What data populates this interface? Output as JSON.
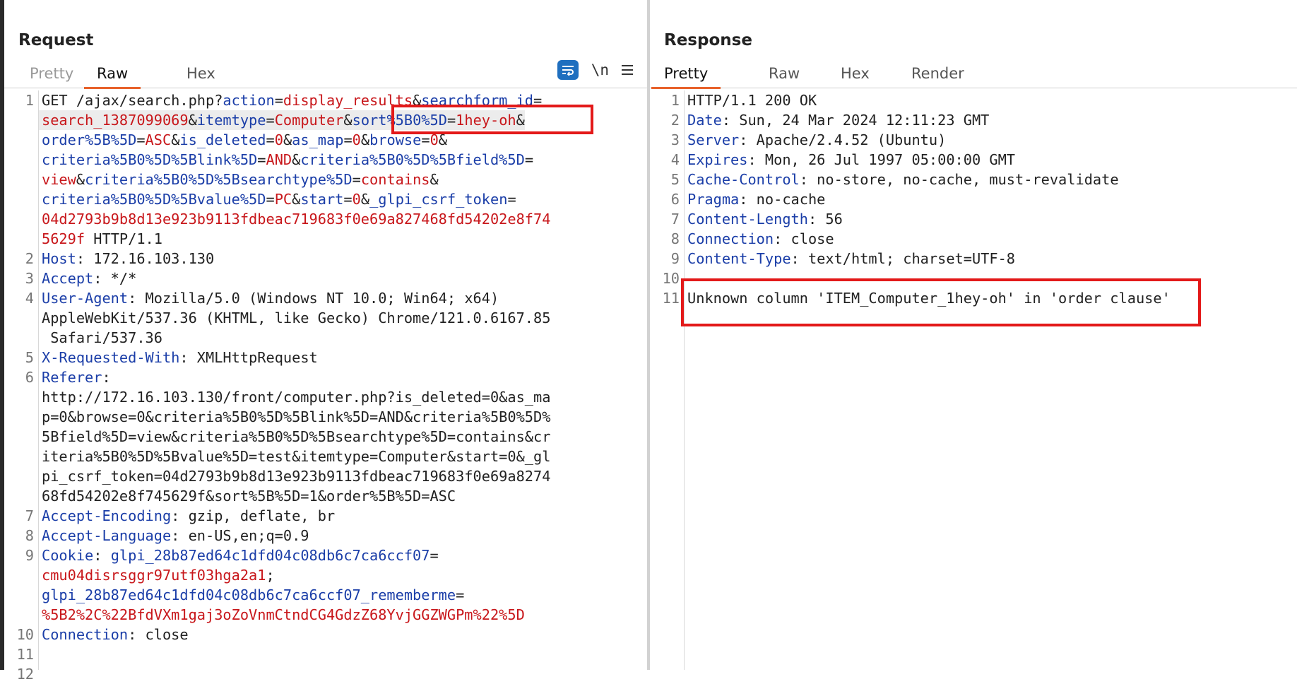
{
  "request": {
    "title": "Request",
    "tabs": [
      "Pretty",
      "Raw",
      "Hex"
    ],
    "active_tab": "Raw",
    "tools": {
      "newline_toggle": "\\n"
    },
    "lines": [
      {
        "num": "1",
        "rows": [
          [
            {
              "t": "GET /ajax/search.php?",
              "c": "p"
            },
            {
              "t": "action",
              "c": "k"
            },
            {
              "t": "=",
              "c": "p"
            },
            {
              "t": "display_results",
              "c": "v"
            },
            {
              "t": "&",
              "c": "p"
            },
            {
              "t": "searchform_id",
              "c": "k"
            },
            {
              "t": "=",
              "c": "p"
            }
          ],
          [
            {
              "t": "search_1387099069",
              "c": "v"
            },
            {
              "t": "&",
              "c": "p"
            },
            {
              "t": "itemtype",
              "c": "k"
            },
            {
              "t": "=",
              "c": "p"
            },
            {
              "t": "Computer",
              "c": "v"
            },
            {
              "t": "&",
              "c": "p"
            },
            {
              "t": "sort%5B0%5D",
              "c": "k"
            },
            {
              "t": "=",
              "c": "p"
            },
            {
              "t": "1hey-oh",
              "c": "v"
            },
            {
              "t": "&",
              "c": "p"
            }
          ],
          [
            {
              "t": "order%5B%5D",
              "c": "k"
            },
            {
              "t": "=",
              "c": "p"
            },
            {
              "t": "ASC",
              "c": "v"
            },
            {
              "t": "&",
              "c": "p"
            },
            {
              "t": "is_deleted",
              "c": "k"
            },
            {
              "t": "=",
              "c": "p"
            },
            {
              "t": "0",
              "c": "v"
            },
            {
              "t": "&",
              "c": "p"
            },
            {
              "t": "as_map",
              "c": "k"
            },
            {
              "t": "=",
              "c": "p"
            },
            {
              "t": "0",
              "c": "v"
            },
            {
              "t": "&",
              "c": "p"
            },
            {
              "t": "browse",
              "c": "k"
            },
            {
              "t": "=",
              "c": "p"
            },
            {
              "t": "0",
              "c": "v"
            },
            {
              "t": "&",
              "c": "p"
            }
          ],
          [
            {
              "t": "criteria%5B0%5D%5Blink%5D",
              "c": "k"
            },
            {
              "t": "=",
              "c": "p"
            },
            {
              "t": "AND",
              "c": "v"
            },
            {
              "t": "&",
              "c": "p"
            },
            {
              "t": "criteria%5B0%5D%5Bfield%5D",
              "c": "k"
            },
            {
              "t": "=",
              "c": "p"
            }
          ],
          [
            {
              "t": "view",
              "c": "v"
            },
            {
              "t": "&",
              "c": "p"
            },
            {
              "t": "criteria%5B0%5D%5Bsearchtype%5D",
              "c": "k"
            },
            {
              "t": "=",
              "c": "p"
            },
            {
              "t": "contains",
              "c": "v"
            },
            {
              "t": "&",
              "c": "p"
            }
          ],
          [
            {
              "t": "criteria%5B0%5D%5Bvalue%5D",
              "c": "k"
            },
            {
              "t": "=",
              "c": "p"
            },
            {
              "t": "PC",
              "c": "v"
            },
            {
              "t": "&",
              "c": "p"
            },
            {
              "t": "start",
              "c": "k"
            },
            {
              "t": "=",
              "c": "p"
            },
            {
              "t": "0",
              "c": "v"
            },
            {
              "t": "&",
              "c": "p"
            },
            {
              "t": "_glpi_csrf_token",
              "c": "k"
            },
            {
              "t": "=",
              "c": "p"
            }
          ],
          [
            {
              "t": "04d2793b9b8d13e923b9113fdbeac719683f0e69a827468fd54202e8f74",
              "c": "v"
            }
          ],
          [
            {
              "t": "5629f",
              "c": "v"
            },
            {
              "t": " HTTP/1.1",
              "c": "p"
            }
          ]
        ]
      },
      {
        "num": "2",
        "rows": [
          [
            {
              "t": "Host",
              "c": "k"
            },
            {
              "t": ": 172.16.103.130",
              "c": "p"
            }
          ]
        ]
      },
      {
        "num": "3",
        "rows": [
          [
            {
              "t": "Accept",
              "c": "k"
            },
            {
              "t": ": */*",
              "c": "p"
            }
          ]
        ]
      },
      {
        "num": "4",
        "rows": [
          [
            {
              "t": "User-Agent",
              "c": "k"
            },
            {
              "t": ": Mozilla/5.0 (Windows NT 10.0; Win64; x64)",
              "c": "p"
            }
          ],
          [
            {
              "t": "AppleWebKit/537.36 (KHTML, like Gecko) Chrome/121.0.6167.85",
              "c": "p"
            }
          ],
          [
            {
              "t": " Safari/537.36",
              "c": "p"
            }
          ]
        ]
      },
      {
        "num": "5",
        "rows": [
          [
            {
              "t": "X-Requested-With",
              "c": "k"
            },
            {
              "t": ": XMLHttpRequest",
              "c": "p"
            }
          ]
        ]
      },
      {
        "num": "6",
        "rows": [
          [
            {
              "t": "Referer",
              "c": "k"
            },
            {
              "t": ":",
              "c": "p"
            }
          ],
          [
            {
              "t": "http://172.16.103.130/front/computer.php?is_deleted=0&as_ma",
              "c": "p"
            }
          ],
          [
            {
              "t": "p=0&browse=0&criteria%5B0%5D%5Blink%5D=AND&criteria%5B0%5D%",
              "c": "p"
            }
          ],
          [
            {
              "t": "5Bfield%5D=view&criteria%5B0%5D%5Bsearchtype%5D=contains&cr",
              "c": "p"
            }
          ],
          [
            {
              "t": "iteria%5B0%5D%5Bvalue%5D=test&itemtype=Computer&start=0&_gl",
              "c": "p"
            }
          ],
          [
            {
              "t": "pi_csrf_token=04d2793b9b8d13e923b9113fdbeac719683f0e69a8274",
              "c": "p"
            }
          ],
          [
            {
              "t": "68fd54202e8f745629f&sort%5B%5D=1&order%5B%5D=ASC",
              "c": "p"
            }
          ]
        ]
      },
      {
        "num": "7",
        "rows": [
          [
            {
              "t": "Accept-Encoding",
              "c": "k"
            },
            {
              "t": ": gzip, deflate, br",
              "c": "p"
            }
          ]
        ]
      },
      {
        "num": "8",
        "rows": [
          [
            {
              "t": "Accept-Language",
              "c": "k"
            },
            {
              "t": ": en-US,en;q=0.9",
              "c": "p"
            }
          ]
        ]
      },
      {
        "num": "9",
        "rows": [
          [
            {
              "t": "Cookie",
              "c": "k"
            },
            {
              "t": ": ",
              "c": "p"
            },
            {
              "t": "glpi_28b87ed64c1dfd04c08db6c7ca6ccf07",
              "c": "k"
            },
            {
              "t": "=",
              "c": "p"
            }
          ],
          [
            {
              "t": "cmu04disrsggr97utf03hga2a1",
              "c": "v"
            },
            {
              "t": ";",
              "c": "p"
            }
          ],
          [
            {
              "t": "glpi_28b87ed64c1dfd04c08db6c7ca6ccf07_rememberme",
              "c": "k"
            },
            {
              "t": "=",
              "c": "p"
            }
          ],
          [
            {
              "t": "%5B2%2C%22BfdVXm1gaj3oZoVnmCtndCG4GdzZ68YvjGGZWGPm%22%5D",
              "c": "v"
            }
          ]
        ]
      },
      {
        "num": "10",
        "rows": [
          [
            {
              "t": "Connection",
              "c": "k"
            },
            {
              "t": ": close",
              "c": "p"
            }
          ]
        ]
      },
      {
        "num": "11",
        "rows": [
          []
        ]
      },
      {
        "num": "12",
        "rows": [
          []
        ]
      }
    ]
  },
  "response": {
    "title": "Response",
    "tabs": [
      "Pretty",
      "Raw",
      "Hex",
      "Render"
    ],
    "active_tab": "Pretty",
    "lines": [
      {
        "num": "1",
        "rows": [
          [
            {
              "t": "HTTP/1.1 200 OK",
              "c": "p"
            }
          ]
        ]
      },
      {
        "num": "2",
        "rows": [
          [
            {
              "t": "Date",
              "c": "k"
            },
            {
              "t": ": Sun, 24 Mar 2024 12:11:23 GMT",
              "c": "p"
            }
          ]
        ]
      },
      {
        "num": "3",
        "rows": [
          [
            {
              "t": "Server",
              "c": "k"
            },
            {
              "t": ": Apache/2.4.52 (Ubuntu)",
              "c": "p"
            }
          ]
        ]
      },
      {
        "num": "4",
        "rows": [
          [
            {
              "t": "Expires",
              "c": "k"
            },
            {
              "t": ": Mon, 26 Jul 1997 05:00:00 GMT",
              "c": "p"
            }
          ]
        ]
      },
      {
        "num": "5",
        "rows": [
          [
            {
              "t": "Cache-Control",
              "c": "k"
            },
            {
              "t": ": no-store, no-cache, must-revalidate",
              "c": "p"
            }
          ]
        ]
      },
      {
        "num": "6",
        "rows": [
          [
            {
              "t": "Pragma",
              "c": "k"
            },
            {
              "t": ": no-cache",
              "c": "p"
            }
          ]
        ]
      },
      {
        "num": "7",
        "rows": [
          [
            {
              "t": "Content-Length",
              "c": "k"
            },
            {
              "t": ": 56",
              "c": "p"
            }
          ]
        ]
      },
      {
        "num": "8",
        "rows": [
          [
            {
              "t": "Connection",
              "c": "k"
            },
            {
              "t": ": close",
              "c": "p"
            }
          ]
        ]
      },
      {
        "num": "9",
        "rows": [
          [
            {
              "t": "Content-Type",
              "c": "k"
            },
            {
              "t": ": text/html; charset=UTF-8",
              "c": "p"
            }
          ]
        ]
      },
      {
        "num": "10",
        "rows": [
          []
        ]
      },
      {
        "num": "11",
        "rows": [
          [
            {
              "t": "Unknown column 'ITEM_Computer_1hey-oh' in 'order clause'",
              "c": "p"
            }
          ]
        ]
      }
    ]
  },
  "colors": {
    "key": "#1b3ea8",
    "value": "#c8171b",
    "highlight_box": "#e31919",
    "active_tab_underline": "#e8622b",
    "wrap_button": "#1f6fbf"
  }
}
